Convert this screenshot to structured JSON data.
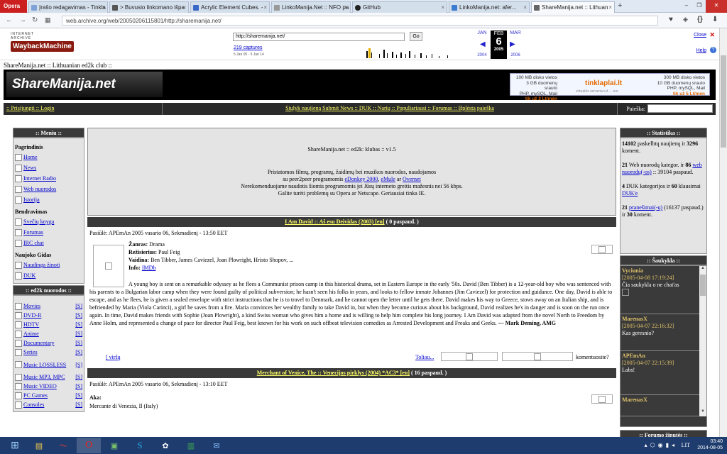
{
  "browser": {
    "opera_label": "Opera",
    "tabs": [
      {
        "title": "Įrašo redagavimas - Tinkla",
        "color": "#7fa3d6"
      },
      {
        "title": "> Buvusio linkomano išpa",
        "color": "#555"
      },
      {
        "title": "Acrylic Element Cubes. -",
        "color": "#3b67c7"
      },
      {
        "title": "LinkoManija.Net :: NFO pa",
        "color": "#999"
      },
      {
        "title": "GitHub",
        "color": "#222"
      },
      {
        "title": "LinkoManija.net: afer...",
        "color": "#3c7bd1"
      },
      {
        "title": "ShareManija.net :: Lithuan",
        "color": "#666"
      }
    ],
    "url": "web.archive.org/web/20050206115801/http://sharemanija.net/"
  },
  "wayback": {
    "ia_text": "INTERNET ARCHIVE",
    "logo_text": "WaybackMachine",
    "url_value": "http://sharemanija.net/",
    "go": "Go",
    "captures": "219 captures",
    "range": "5 Jan 05 - 5 Jan 14",
    "prev_month": "JAN",
    "cur_month": "FEB",
    "next_month": "MAR",
    "day": "6",
    "prev_year": "2004",
    "cur_year": "2005",
    "next_year": "2006",
    "close": "Close",
    "help": "Help"
  },
  "site": {
    "crumb": "ShareManija.net :: Lithuanian ed2k club ::",
    "logo": "ShareManija.net",
    "ad": {
      "l1": "100 MB disko vietos",
      "l2": "3 GB duomenų srauto",
      "l3": "PHP, mySQL, Mail",
      "l4": "tik už 2 Lt/mėn",
      "brand": "tinklaplai.lt",
      "sub": "virtualūs serveriai už ... eur",
      "r1": "300 MB disko vietos",
      "r2": "10 GB duomenų srauto",
      "r3": "PHP, mySQL, Mail",
      "r4": "tik už 5 Lt/mėn"
    },
    "topmenu_left": ":: Prisijungti :: Login",
    "topmenu_mid": "Siųlyk naujieną Submit News :: DUK :: Narių :: Populiariausi :: Forumas :: Išplėsta paieška",
    "search_label": "Paieška:"
  },
  "menu": {
    "head": ":: Meniu ::",
    "section1": "Pagrindinis",
    "main_items": [
      "Home",
      "News",
      "Internet Radio",
      "Web nuorodos",
      "Istorija"
    ],
    "section2": "Bendravimas",
    "comm_items": [
      "Svečių knyga",
      "Forumas",
      "IRC chat"
    ],
    "section3": "Naujoko Gidas",
    "guide_items": [
      "Naudinga žinoti",
      "DUK"
    ],
    "ed2k_head": ":: ed2k nuorodos ::",
    "ed2k_items": [
      "Movies",
      "DVD-R",
      "HDTV",
      "Anime",
      "Documentary",
      "Series",
      "Music LOSSLESS",
      "Music MP3, MPC",
      "Music VIDEO",
      "PC Games",
      "Consoles"
    ],
    "s": "[S]"
  },
  "intro": {
    "line1": "ShareManija.net :: ed2k: klubas :: v1.5",
    "line2": "Pristatomos filmų, programų, žaidimų bei muzikos nuorodos, naudojamos",
    "line3a": "su peer2peer programomis",
    "l_edonkey": "eDonkey 2000",
    "l_emule": "eMule",
    "ar": "ar",
    "l_overnet": "Overnet",
    "line4": "Nerekomenduojame naudotis šiomis programomis jei Jūsų interneto greitis mažesnis nei 56 kbps.",
    "line5": "Galite turėti problemų su Opera ar Netscape. Geriausiai tinka IE."
  },
  "article1": {
    "title": "I Am David :: Aš esu Deividas (2003) [en]",
    "views": "( 0 paspaud. )",
    "posted": "Pasiūlė: APEmAn 2005 vasario 06, Sekmadienį - 13:50 EET",
    "genre_label": "Žanras:",
    "genre": "Drama",
    "dir_label": "Režisierius:",
    "dir": "Paul Feig",
    "cast_label": "Vaidina:",
    "cast": "Ben Tibber, James Caviezel, Joan Plowright, Hristo Shopov, ...",
    "info_label": "Info:",
    "info": "IMDb",
    "desc": "A young boy is sent on a remarkable odyssey as he flees a Communist prison camp in this historical drama, set in Eastern Europe in the early '50s. David (Ben Tibber) is a 12-year-old boy who was sentenced with his parents to a Bulgarian labor camp when they were found guilty of political subversion; he hasn't seen his folks in years, and looks to fellow inmate Johannes (Jim Caviezel) for protection and guidance. One day, David is able to escape, and as he flees, he is given a sealed envelope with strict instructions that he is to travel to Denmark, and he cannot open the letter until he gets there. David makes his way to Greece, stows away on an Italian ship, and is befriended by Maria (Viola Carinci), a girl he saves from a fire. Maria convinces her wealthy family to take David in, but when they become curious about his background, David realizes he's in danger and is soon on the run once again. In time, David makes friends with Sophie (Joan Plowright), a kind Swiss woman who gives him a home and is willing to help him complete his long journey. I Am David was adapted from the novel North to Freedom by Anne Holm, and represented a change of pace for director Paul Feig, best known for his work on such offbeat television comedies as Arrested Development and Freaks and Geeks.",
    "author": "--- Mark Deming, AMG",
    "top": "[ viršų",
    "more": "Toliau...",
    "comments": "komentuosite?"
  },
  "article2": {
    "title": "Merchant of Venice, The :: Venecijos pirklys (2004) *AC3* [en]",
    "views": "( 16 paspaud. )",
    "posted": "Pasiūlė: APEmAn 2005 vasario 06, Sekmadienį - 13:10 EET",
    "aka_label": "Aka:",
    "aka": "Mercante di Venezia, Il (Italy)"
  },
  "stats": {
    "head": ":: Statistika ::",
    "p1a": "14102",
    "p1b": "paskelbtų naujienų ir",
    "p1c": "3296",
    "p1d": "koment.",
    "p2a": "21",
    "p2b": "Web nuorodų kategor. ir",
    "p2c": "86",
    "p2link": "web nuorodų(-os)",
    "p2e": ":: 39104 paspaud.",
    "p3a": "4",
    "p3b": "DUK kategorijos ir",
    "p3c": "60",
    "p3d": "klausimai",
    "p3link": "DUK'e",
    "p4a": "21",
    "p4link": "pranešimai(-ų)",
    "p4b": "(16137 paspaud.) ir",
    "p4c": "30",
    "p4d": "koment."
  },
  "shout": {
    "head": ":: Šaukykla ::",
    "items": [
      {
        "user": "Vyciunia",
        "date": "[2005-04-08 17:19:24]",
        "msg": "Čia saukykla o ne chat'as"
      },
      {
        "user": "MarenasX",
        "date": "[2005-04-07 22:16:32]",
        "msg": "Kas geresnio?"
      },
      {
        "user": "APEmAn",
        "date": "[2005-04-07 22:15:39]",
        "msg": "Labs!"
      },
      {
        "user": "MarenasX",
        "date": "",
        "msg": ""
      }
    ],
    "forum_head": ":: Forumo žinutės ::"
  },
  "tray": {
    "lang": "LIT",
    "time": "03:40",
    "date": "2014-08-05"
  }
}
